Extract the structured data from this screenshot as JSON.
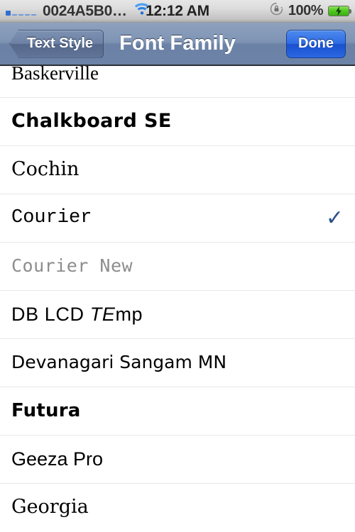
{
  "status_bar": {
    "carrier": "0024A5B0…",
    "signal_bars_filled": 1,
    "signal_bars_total": 5,
    "wifi_icon": "wifi-icon",
    "time": "12:12 AM",
    "rotation_lock_icon": "rotation-lock-icon",
    "battery_percent": "100%",
    "battery_icon": "battery-charging-icon"
  },
  "nav_bar": {
    "back_label": "Text Style",
    "title": "Font Family",
    "done_label": "Done"
  },
  "list": {
    "selected_font": "Courier",
    "checkmark_glyph": "✓",
    "checkmark_color": "#2d5089",
    "rows": [
      {
        "label": "Baskerville",
        "style": "f-serif",
        "checked": false,
        "clipped": true
      },
      {
        "label": "Chalkboard SE",
        "style": "f-chalk",
        "checked": false,
        "clipped": false
      },
      {
        "label": "Cochin",
        "style": "f-serif-n",
        "checked": false,
        "clipped": false
      },
      {
        "label": "Courier",
        "style": "f-mono",
        "checked": true,
        "clipped": false
      },
      {
        "label": "Courier New",
        "style": "f-mono-light",
        "checked": false,
        "clipped": false
      },
      {
        "label": "DB LCD TEmp",
        "style": "f-lcd",
        "checked": false,
        "clipped": false
      },
      {
        "label": "Devanagari Sangam MN",
        "style": "f-sans-n",
        "checked": false,
        "clipped": false
      },
      {
        "label": "Futura",
        "style": "f-futura",
        "checked": false,
        "clipped": false
      },
      {
        "label": "Geeza Pro",
        "style": "f-sans",
        "checked": false,
        "clipped": false
      },
      {
        "label": "Georgia",
        "style": "f-serif-n",
        "checked": false,
        "clipped": false
      }
    ]
  }
}
